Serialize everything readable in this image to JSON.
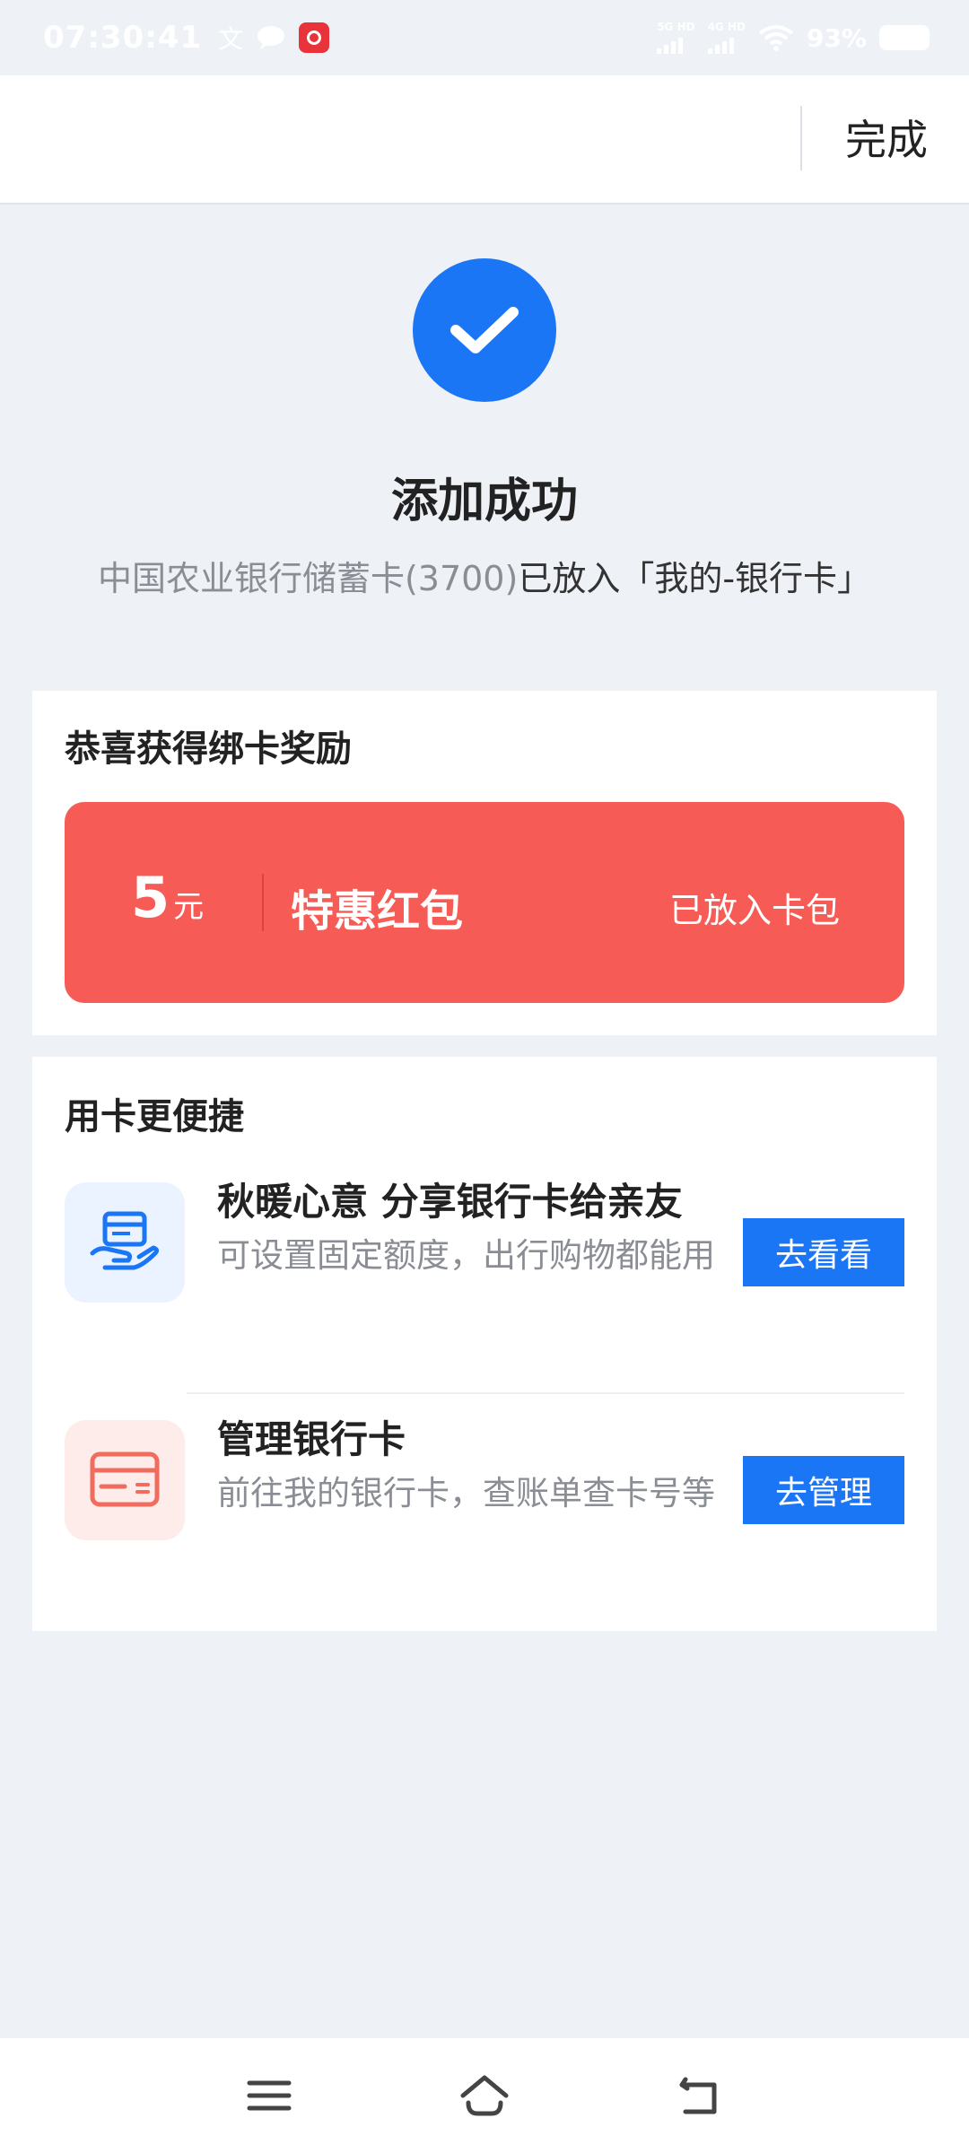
{
  "status_bar": {
    "time": "07:30:41",
    "net1": "5G HD",
    "net2": "4G HD",
    "battery_pct": "93%"
  },
  "header": {
    "done_label": "完成"
  },
  "result": {
    "title": "添加成功",
    "desc_part1": "中国农业银行储蓄卡(3700)",
    "desc_part2": "已放入「我的-银行卡」"
  },
  "reward": {
    "title": "恭喜获得绑卡奖励",
    "amount": "5",
    "unit": "元",
    "name": "特惠红包",
    "status": "已放入卡包"
  },
  "convenience": {
    "title": "用卡更便捷",
    "items": [
      {
        "title": "秋暖心意 分享银行卡给亲友",
        "desc": "可设置固定额度，出行购物都能用",
        "action": "去看看",
        "icon": "share-card-hand-icon",
        "color": "#1b76f5"
      },
      {
        "title": "管理银行卡",
        "desc": "前往我的银行卡，查账单查卡号等",
        "action": "去管理",
        "icon": "bank-card-icon",
        "color": "#ef6c5f"
      }
    ]
  },
  "colors": {
    "accent": "#1b76f5",
    "red_packet": "#f65b55",
    "background": "#eef1f6"
  }
}
